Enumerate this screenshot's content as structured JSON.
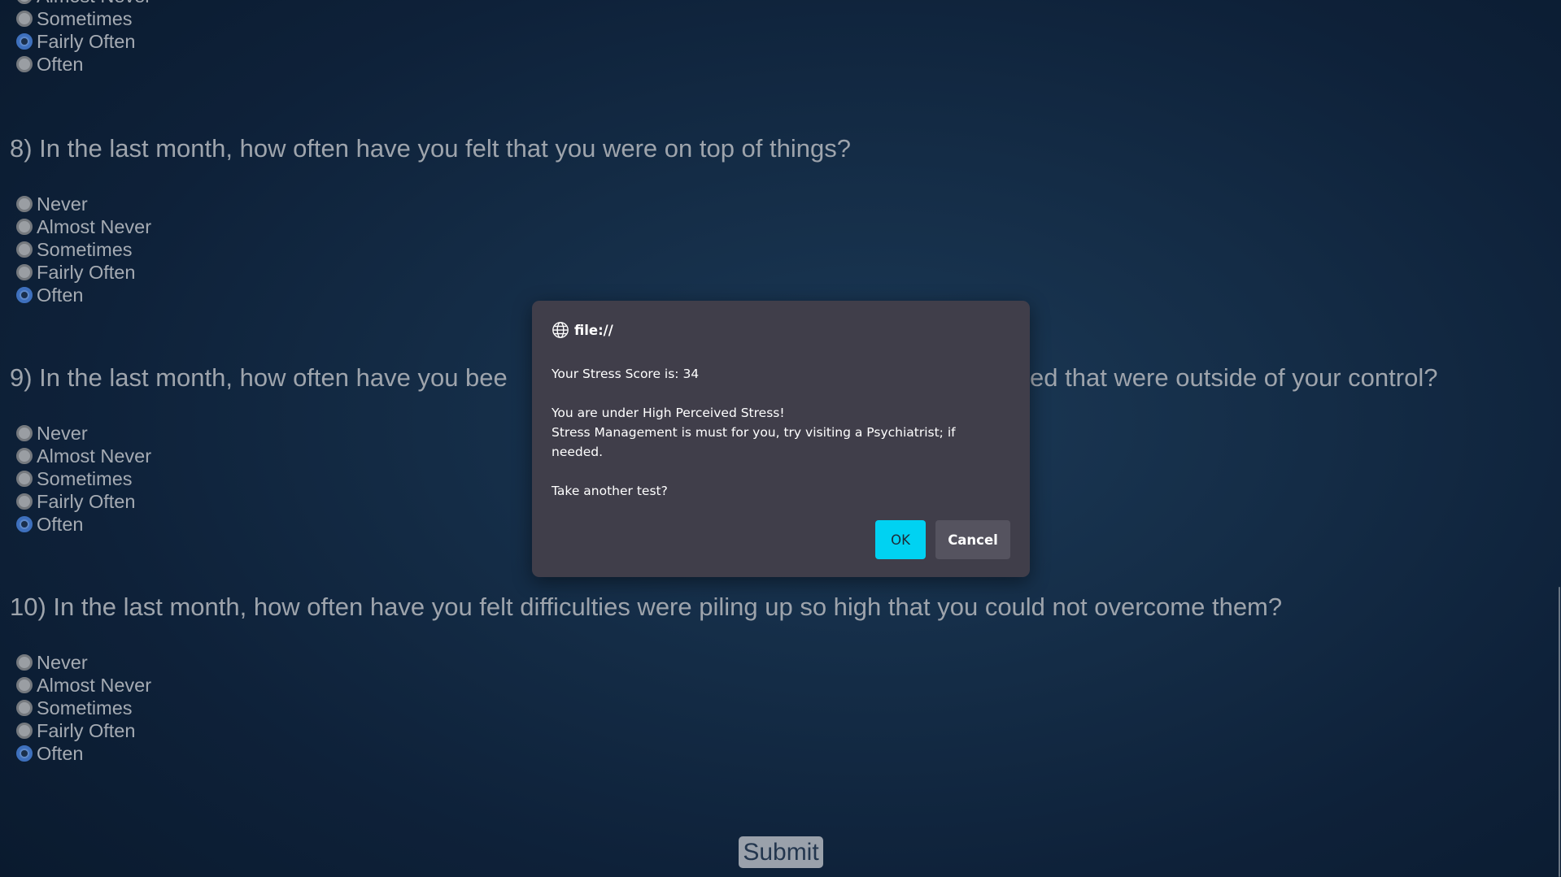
{
  "question7": {
    "options": [
      {
        "label": "Almost Never",
        "checked": false
      },
      {
        "label": "Sometimes",
        "checked": false
      },
      {
        "label": "Fairly Often",
        "checked": true
      },
      {
        "label": "Often",
        "checked": false
      }
    ]
  },
  "question8": {
    "text": "8) In the last month, how often have you felt that you were on top of things?",
    "options": [
      {
        "label": "Never",
        "checked": false
      },
      {
        "label": "Almost Never",
        "checked": false
      },
      {
        "label": "Sometimes",
        "checked": false
      },
      {
        "label": "Fairly Often",
        "checked": false
      },
      {
        "label": "Often",
        "checked": true
      }
    ]
  },
  "question9": {
    "text_left": "9) In the last month, how often have you bee",
    "text_right": "ed that were outside of your control?",
    "options": [
      {
        "label": "Never",
        "checked": false
      },
      {
        "label": "Almost Never",
        "checked": false
      },
      {
        "label": "Sometimes",
        "checked": false
      },
      {
        "label": "Fairly Often",
        "checked": false
      },
      {
        "label": "Often",
        "checked": true
      }
    ]
  },
  "question10": {
    "text": "10) In the last month, how often have you felt difficulties were piling up so high that you could not overcome them?",
    "options": [
      {
        "label": "Never",
        "checked": false
      },
      {
        "label": "Almost Never",
        "checked": false
      },
      {
        "label": "Sometimes",
        "checked": false
      },
      {
        "label": "Fairly Often",
        "checked": false
      },
      {
        "label": "Often",
        "checked": true
      }
    ]
  },
  "submit_label": "Submit",
  "dialog": {
    "origin": "file://",
    "score_line": "Your Stress Score is: 34",
    "verdict": "You are under High Perceived Stress!",
    "advice": "Stress Management is must for you, try visiting a Psychiatrist; if needed.",
    "prompt": "Take another test?",
    "ok_label": "OK",
    "cancel_label": "Cancel"
  },
  "colors": {
    "accent_ok": "#00d2f2",
    "dialog_bg": "#403e4a",
    "radio_checked": "#3e70bd",
    "page_bg": "#142c46"
  }
}
